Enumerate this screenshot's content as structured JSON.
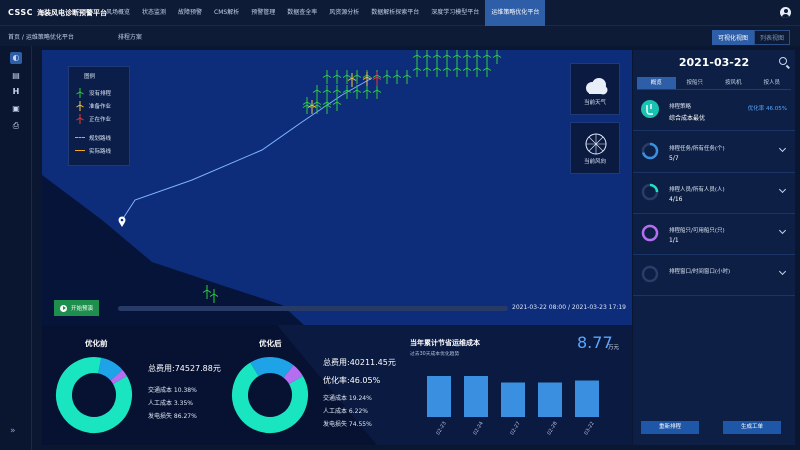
{
  "brand": {
    "logo": "CSSC",
    "title": "海装风电诊断预警平台"
  },
  "menu": [
    "风场概览",
    "状态监测",
    "故障预警",
    "CMS解析",
    "预警管理",
    "数据查全率",
    "风资源分析",
    "数据解析探索平台",
    "深度学习模型平台",
    "运维策略优化平台"
  ],
  "menu_active_index": 9,
  "breadcrumb": "首页 / 运维策略优化平台",
  "subtab": "排程方案",
  "view_toggle": {
    "visual": "可视化视图",
    "list": "列表视图"
  },
  "legend": {
    "title": "图例",
    "items": [
      "没有排程",
      "准备作业",
      "正在作业",
      "规划路线",
      "实际路线"
    ],
    "colors": {
      "none": "#2ecc40",
      "ready": "#f5c542",
      "working": "#e53935",
      "planned": "#7fb3ff",
      "actual": "#f5a623"
    }
  },
  "weather_label": "当前天气",
  "wind_label": "当前风向",
  "play_label": "开始预演",
  "time_range": "2021-03-22 08:00 / 2021-03-23 17:19",
  "cost": {
    "before": {
      "title": "优化前",
      "total": "总费用:74527.88元",
      "traffic": "交通成本 10.38%",
      "labor": "人工成本 3.35%",
      "power": "发电损失 86.27%",
      "shares": [
        86.27,
        10.38,
        3.35
      ]
    },
    "after": {
      "title": "优化后",
      "total": "总费用:40211.45元",
      "rate": "优化率:46.05%",
      "traffic": "交通成本 19.24%",
      "labor": "人工成本 6.22%",
      "power": "发电损失 74.55%",
      "shares": [
        74.55,
        19.24,
        6.22
      ]
    },
    "colors": [
      "#19e6c1",
      "#1fa3e8",
      "#b56ef0"
    ]
  },
  "saving": {
    "title": "当年累计节省运维成本",
    "subtitle": "过去30天成本优化趋势",
    "value": "8.77",
    "unit": "万元"
  },
  "chart_data": {
    "type": "bar",
    "categories": [
      "02-23",
      "02-24",
      "02-27",
      "02-28",
      "03-22"
    ],
    "values": [
      8.2,
      8.2,
      6.9,
      6.9,
      7.3
    ],
    "title": "当年累计节省运维成本",
    "xlabel": "",
    "ylabel": "",
    "ylim": [
      0,
      10
    ],
    "color": "#3b8fe0"
  },
  "right_panel": {
    "date": "2021-03-22",
    "tabs": [
      "概览",
      "按船只",
      "按风机",
      "按人员"
    ],
    "strategy_label": "排程策略",
    "strategy_value": "综合成本最优",
    "strategy_ratio": "优化率 46.05%",
    "items": [
      {
        "label": "排程任务/所有任务(个)",
        "value": "5/7",
        "fraction": 0.71,
        "color": "#3b8fe0"
      },
      {
        "label": "排程人员/所有人员(人)",
        "value": "4/16",
        "fraction": 0.25,
        "color": "#19e6c1"
      },
      {
        "label": "排程船只/可用船只(只)",
        "value": "1/1",
        "fraction": 1.0,
        "color": "#b56ef0"
      },
      {
        "label": "排程窗口/时间窗口(小时)",
        "value": "",
        "fraction": 0,
        "color": "#3b8fe0"
      }
    ],
    "reschedule": "重新排程",
    "create_order": "生成工单"
  }
}
